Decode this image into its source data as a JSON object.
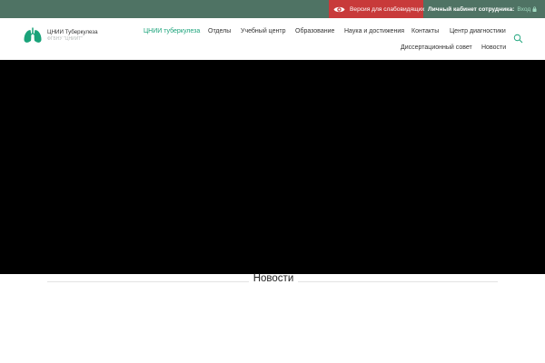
{
  "topbar": {
    "visually_impaired_label": "Версия для слабовидящих",
    "cabinet_label": "Личный кабинет сотрудника:",
    "login_label": "Вход",
    "bg_color": "#4f7364",
    "vi_button_color": "#c83a3a"
  },
  "header": {
    "logo": {
      "title": "ЦНИИ Туберкулеза",
      "subtitle": "ФГБНУ \"ЦНИИТ\"",
      "icon": "lungs-icon",
      "color": "#1aa37a"
    },
    "nav": [
      {
        "label": "ЦНИИ туберкулеза",
        "active": true
      },
      {
        "label": "Отделы",
        "active": false
      },
      {
        "label": "Учебный центр",
        "active": false
      },
      {
        "label": "Образование",
        "active": false
      },
      {
        "label": "Наука и достижения",
        "active": false
      },
      {
        "label": "Контакты",
        "active": false
      },
      {
        "label": "Центр диагностики",
        "active": false
      },
      {
        "label": "Диссертационный совет",
        "active": false
      },
      {
        "label": "Новости",
        "active": false
      }
    ],
    "search_icon": "search-icon"
  },
  "hero": {
    "bg_color": "#000000"
  },
  "news": {
    "title": "Новости"
  }
}
